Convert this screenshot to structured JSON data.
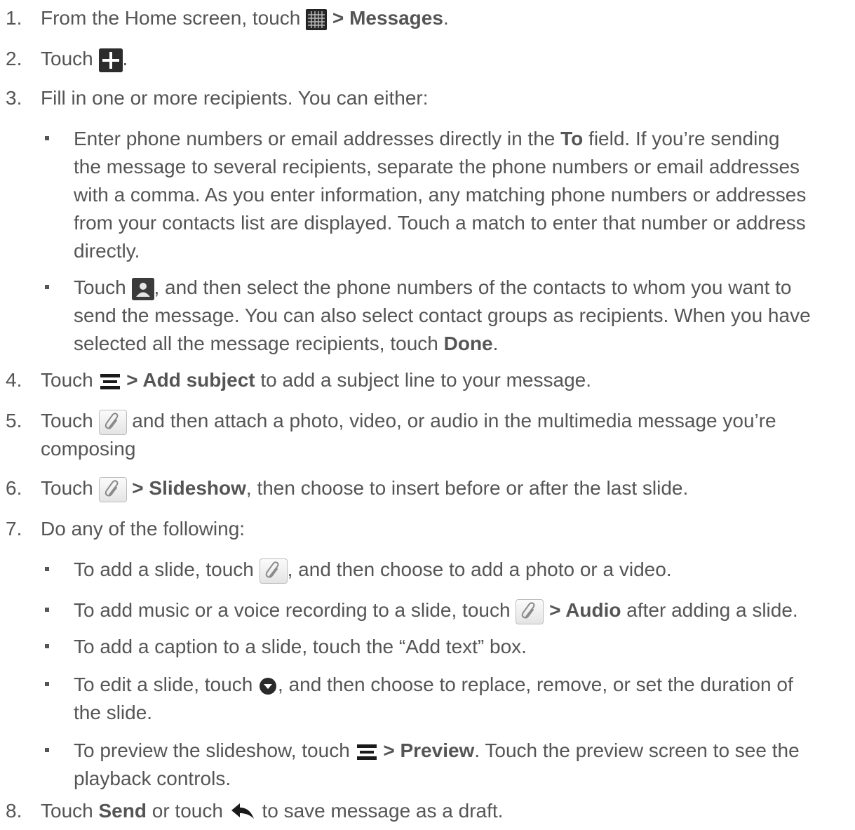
{
  "steps": [
    {
      "num": "1.",
      "a": "From the Home screen, touch ",
      "icon": "apps-grid-icon",
      "b": " > Messages",
      "c": "."
    },
    {
      "num": "2.",
      "a": "Touch ",
      "icon": "plus-icon",
      "b": "",
      "c": "."
    },
    {
      "num": "3.",
      "a": "Fill in one or more recipients. You can either:"
    },
    {
      "num": "4.",
      "a": "Touch ",
      "icon": "menu-icon",
      "b": " > Add subject",
      "c": " to add a subject line to your message."
    },
    {
      "num": "5.",
      "a": "Touch ",
      "icon": "paperclip-icon",
      "c": " and then attach a photo, video, or audio in the multimedia message you’re",
      "c2": "composing"
    },
    {
      "num": "6.",
      "a": "Touch ",
      "icon": "paperclip-icon",
      "b": " > Slideshow",
      "c": ", then choose to insert before or after the last slide."
    },
    {
      "num": "7.",
      "a": "Do any of the following:"
    },
    {
      "num": "8.",
      "a": "Touch ",
      "b": "Send",
      "c": " or touch ",
      "icon": "back-arrow-icon",
      "d": " to save message as a draft."
    }
  ],
  "step3_bullets": [
    {
      "lines": [
        [
          "Enter phone numbers or email addresses directly in the ",
          "To",
          " field. If you’re sending"
        ],
        "the message to several recipients, separate the phone numbers or email addresses",
        "with a comma. As you enter information, any matching phone numbers or addresses",
        "from your contacts list are displayed. Touch a match to enter that number or address",
        "directly."
      ]
    },
    {
      "a": "Touch ",
      "icon": "contact-icon",
      "b": ", and then select the phone numbers of the contacts to whom you want to",
      "line2": "send the message. You can also select contact groups as recipients. When you have",
      "line3a": "selected all the message recipients, touch ",
      "line3b": "Done",
      "line3c": "."
    }
  ],
  "step7_bullets": [
    {
      "a": "To add a slide, touch ",
      "icon": "paperclip-icon",
      "b": ", and then choose to add a photo or a video."
    },
    {
      "a": "To add music or a voice recording to a slide, touch ",
      "icon": "paperclip-icon",
      "b": " > Audio",
      "c": " after adding a slide."
    },
    {
      "a": "To add a caption to a slide, touch the “Add text” box."
    },
    {
      "a": "To edit a slide, touch ",
      "icon": "dropdown-circle-icon",
      "b": ", and then choose to replace, remove, or set the duration of",
      "line2": "the slide."
    },
    {
      "a": "To preview the slideshow, touch ",
      "icon": "menu-icon",
      "b": " > Preview",
      "c": ". Touch the preview screen to see the",
      "line2": "playback controls."
    }
  ]
}
